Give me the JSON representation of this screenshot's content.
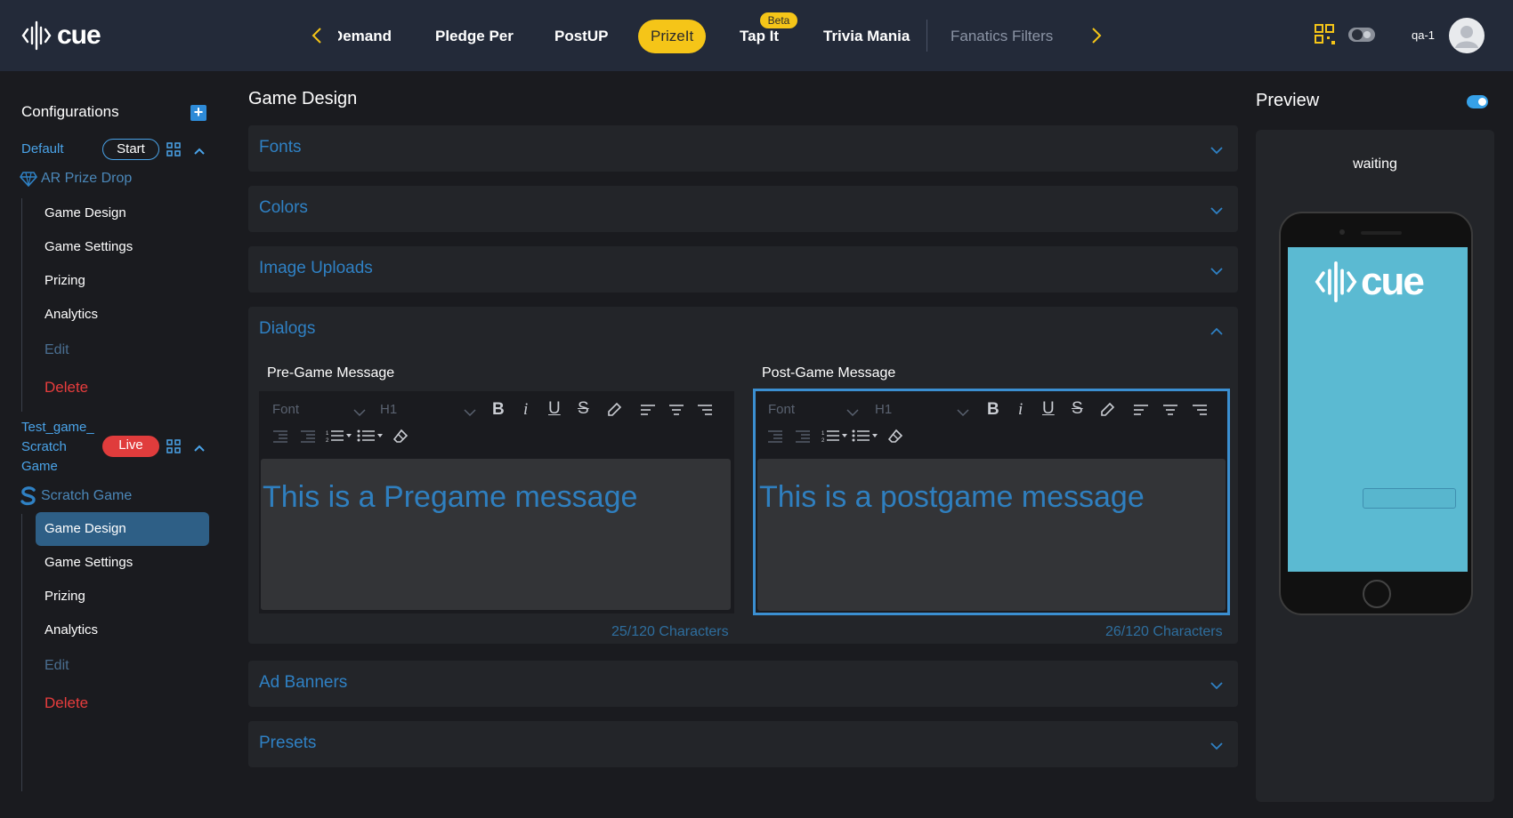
{
  "brand": {
    "logo_text": "cue"
  },
  "nav": {
    "tabs": [
      {
        "label": "Demand"
      },
      {
        "label": "Pledge Per"
      },
      {
        "label": "PostUP"
      },
      {
        "label": "PrizeIt"
      },
      {
        "label": "Tap It"
      },
      {
        "label": "Trivia Mania"
      },
      {
        "label": "Fanatics Filters"
      }
    ],
    "active_tab": "PrizeIt",
    "beta_badge": "Beta",
    "user": "qa-1"
  },
  "sidebar": {
    "title": "Configurations",
    "add_icon": "plus-square-icon",
    "configs": [
      {
        "name": "Default",
        "status": "Start",
        "game": "AR Prize Drop",
        "game_icon": "gem-icon",
        "items": [
          "Game Design",
          "Game Settings",
          "Prizing",
          "Analytics",
          "Edit",
          "Delete"
        ]
      },
      {
        "name_lines": [
          "Test_game_",
          "Scratch",
          "Game"
        ],
        "status": "Live",
        "game": "Scratch Game",
        "game_icon": "scratch-s-icon",
        "items": [
          "Game Design",
          "Game Settings",
          "Prizing",
          "Analytics",
          "Edit",
          "Delete"
        ],
        "selected_item": "Game Design"
      }
    ]
  },
  "main": {
    "title": "Game Design",
    "sections": {
      "fonts": "Fonts",
      "colors": "Colors",
      "image_uploads": "Image Uploads",
      "dialogs": "Dialogs",
      "ad_banners": "Ad Banners",
      "presets": "Presets"
    },
    "dialogs": {
      "pregame": {
        "label": "Pre-Game Message",
        "font_placeholder": "Font",
        "heading": "H1",
        "text": "This is a Pregame message",
        "count": "25/120 Characters"
      },
      "postgame": {
        "label": "Post-Game Message",
        "font_placeholder": "Font",
        "heading": "H1",
        "text": "This is a postgame message",
        "count": "26/120 Characters"
      }
    }
  },
  "preview": {
    "title": "Preview",
    "status": "waiting",
    "toggle_on": true,
    "phone_logo_text": "cue",
    "screen_color": "#5bbad2"
  },
  "colors": {
    "accent": "#f5c518",
    "brand_blue": "#2f81c4",
    "live_red": "#e03c3c",
    "delete_red": "#e83d3d"
  }
}
